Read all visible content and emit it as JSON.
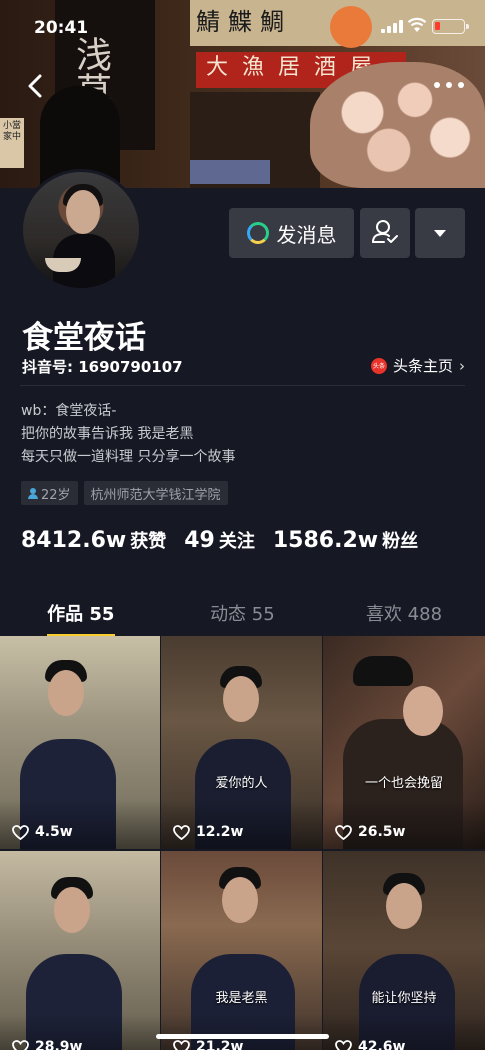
{
  "status": {
    "time": "20:41"
  },
  "banner": {
    "curtain_text": "浅草",
    "lamp_text": "鯖鰈鯛",
    "red_sign_text": "大漁居酒屋",
    "vertical_sign_text": "小當家中"
  },
  "profile": {
    "name": "食堂夜话",
    "douyin_id": "抖音号: 1690790107",
    "toutiao_label": "头条主页",
    "toutiao_logo": "头条",
    "bio_lines": [
      "wb：食堂夜话-",
      "把你的故事告诉我 我是老黑",
      "每天只做一道料理 只分享一个故事"
    ],
    "tags": [
      "22岁",
      "杭州师范大学钱江学院"
    ]
  },
  "actions": {
    "message_label": "发消息"
  },
  "stats": [
    {
      "value": "8412.6w",
      "label": "获赞"
    },
    {
      "value": "49",
      "label": "关注"
    },
    {
      "value": "1586.2w",
      "label": "粉丝"
    }
  ],
  "tabs": [
    {
      "label": "作品 55",
      "active": true
    },
    {
      "label": "动态 55",
      "active": false
    },
    {
      "label": "喜欢 488",
      "active": false
    }
  ],
  "videos": [
    {
      "likes": "4.5w",
      "caption": ""
    },
    {
      "likes": "12.2w",
      "caption": "爱你的人"
    },
    {
      "likes": "26.5w",
      "caption": "一个也会挽留"
    },
    {
      "likes": "28.9w",
      "caption": ""
    },
    {
      "likes": "21.2w",
      "caption": "我是老黑"
    },
    {
      "likes": "42.6w",
      "caption": "能让你坚持"
    }
  ],
  "colors": {
    "background": "#161823",
    "accent_tab": "#facd2f",
    "button_bg": "#393b44"
  }
}
